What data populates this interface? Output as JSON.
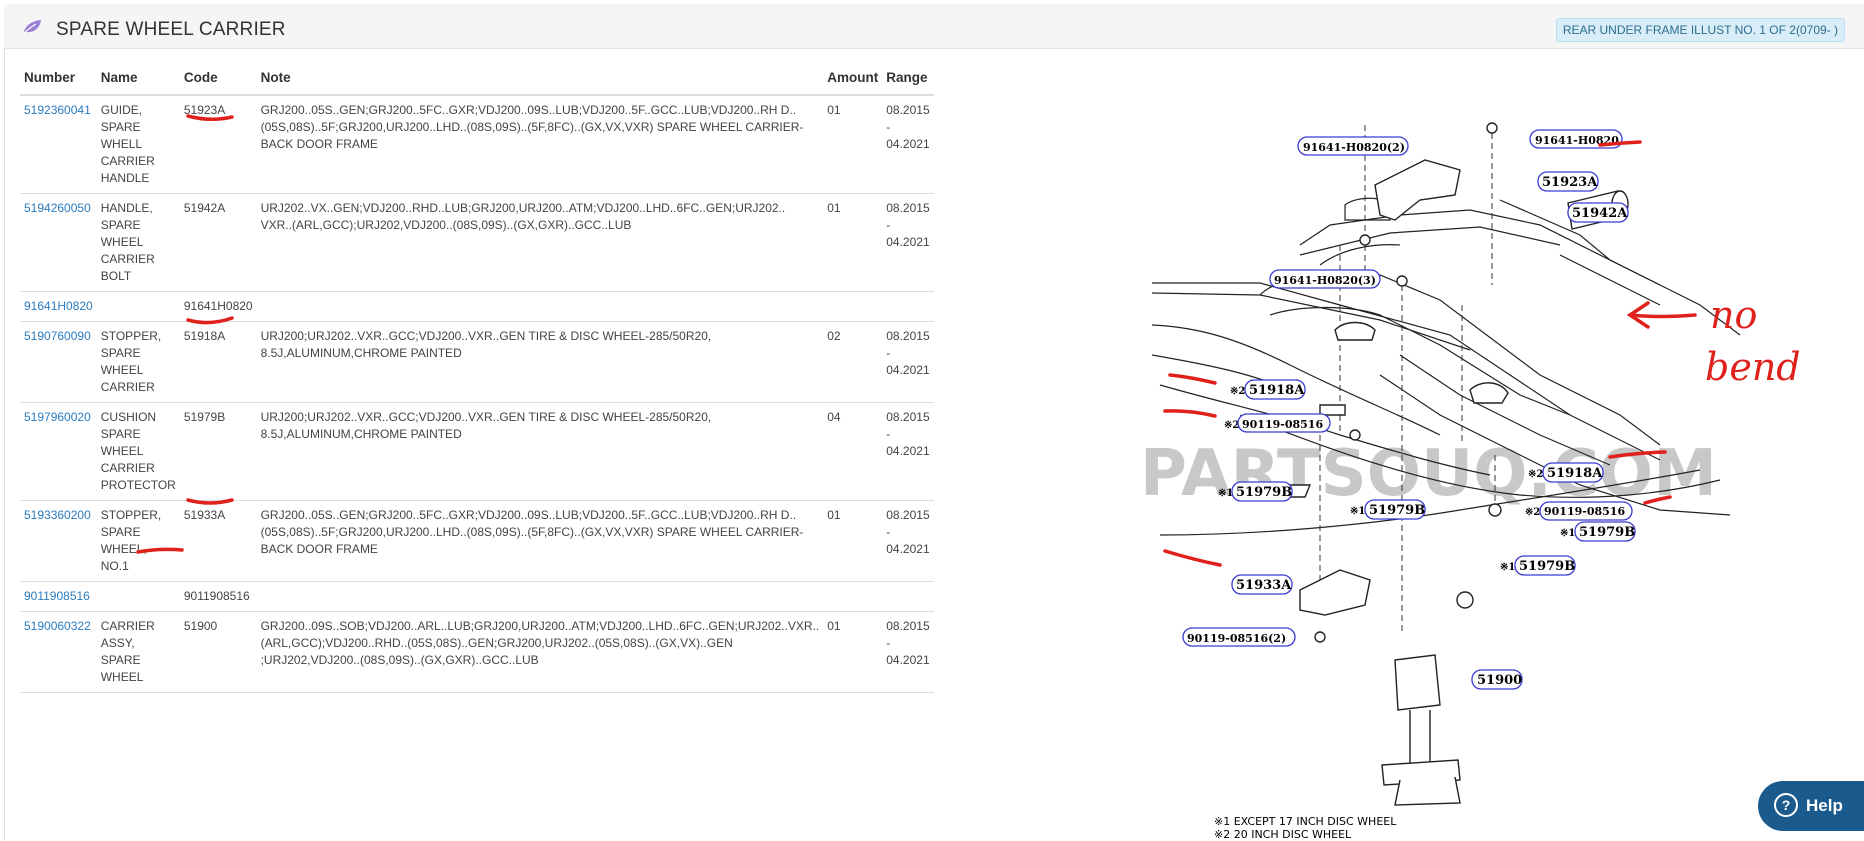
{
  "header": {
    "title": "SPARE WHEEL CARRIER",
    "illust_badge": "REAR UNDER FRAME ILLUST NO. 1 OF 2(0709- )"
  },
  "table": {
    "headers": [
      "Number",
      "Name",
      "Code",
      "Note",
      "Amount",
      "Range"
    ],
    "rows": [
      {
        "number": "5192360041",
        "name": "GUIDE, SPARE WHELL CARRIER HANDLE",
        "code": "51923A",
        "note": "GRJ200..05S..GEN;GRJ200..5FC..GXR;VDJ200..09S..LUB;VDJ200..5F..GCC..LUB;VDJ200..RH D..(05S,08S)..5F;GRJ200,URJ200..LHD..(08S,09S)..(5F,8FC)..(GX,VX,VXR) SPARE WHEEL CARRIER-BACK DOOR FRAME",
        "amount": "01",
        "range": "08.2015 - 04.2021"
      },
      {
        "number": "5194260050",
        "name": "HANDLE, SPARE WHEEL CARRIER BOLT",
        "code": "51942A",
        "note": "URJ202..VX..GEN;VDJ200..RHD..LUB;GRJ200,URJ200..ATM;VDJ200..LHD..6FC..GEN;URJ202.. VXR..(ARL,GCC);URJ202,VDJ200..(08S,09S)..(GX,GXR)..GCC..LUB",
        "amount": "01",
        "range": "08.2015 - 04.2021"
      },
      {
        "number": "91641H0820",
        "name": "",
        "code": "91641H0820",
        "note": "",
        "amount": "",
        "range": ""
      },
      {
        "number": "5190760090",
        "name": "STOPPER, SPARE WHEEL CARRIER",
        "code": "51918A",
        "note": "URJ200;URJ202..VXR..GCC;VDJ200..VXR..GEN TIRE & DISC WHEEL-285/50R20, 8.5J,ALUMINUM,CHROME PAINTED",
        "amount": "02",
        "range": "08.2015 - 04.2021"
      },
      {
        "number": "5197960020",
        "name": "CUSHION SPARE WHEEL CARRIER PROTECTOR",
        "code": "51979B",
        "note": "URJ200;URJ202..VXR..GCC;VDJ200..VXR..GEN TIRE & DISC WHEEL-285/50R20, 8.5J,ALUMINUM,CHROME PAINTED",
        "amount": "04",
        "range": "08.2015 - 04.2021"
      },
      {
        "number": "5193360200",
        "name": "STOPPER, SPARE WHEEL, NO.1",
        "code": "51933A",
        "note": "GRJ200..05S..GEN;GRJ200..5FC..GXR;VDJ200..09S..LUB;VDJ200..5F..GCC..LUB;VDJ200..RH D..(05S,08S)..5F;GRJ200,URJ200..LHD..(08S,09S)..(5F,8FC)..(GX,VX,VXR) SPARE WHEEL CARRIER-BACK DOOR FRAME",
        "amount": "01",
        "range": "08.2015 - 04.2021"
      },
      {
        "number": "9011908516",
        "name": "",
        "code": "9011908516",
        "note": "",
        "amount": "",
        "range": ""
      },
      {
        "number": "5190060322",
        "name": "CARRIER ASSY, SPARE WHEEL",
        "code": "51900",
        "note": "GRJ200..09S..SOB;VDJ200..ARL..LUB;GRJ200,URJ200..ATM;VDJ200..LHD..6FC..GEN;URJ202..VXR..(ARL,GCC);VDJ200..RHD..(05S,08S)..GEN;GRJ200,URJ202..(05S,08S)..(GX,VX)..GEN ;URJ202,VDJ200..(08S,09S)..(GX,GXR)..GCC..LUB",
        "amount": "01",
        "range": "08.2015 - 04.2021"
      }
    ]
  },
  "diagram": {
    "labels": [
      "91641-H0820(2)",
      "91641-H0820",
      "51923A",
      "51942A",
      "91641-H0820(3)",
      "51918A",
      "90119-08516",
      "51979B",
      "51918A",
      "90119-08516",
      "51979B",
      "51979B",
      "51979B",
      "51933A",
      "90119-08516(2)",
      "51900"
    ],
    "prefix_1": "※1",
    "prefix_2": "※2",
    "watermark": "PARTSOUQ.COM",
    "annotation": [
      "no",
      "bend"
    ],
    "footnotes": [
      "※1 EXCEPT 17 INCH DISC WHEEL",
      "※2 20 INCH DISC WHEEL"
    ]
  },
  "help": {
    "label": "Help"
  },
  "colors": {
    "link": "#2a7bbf",
    "annotation_red": "#e0201b",
    "label_border": "#3a3ad0",
    "help_bg": "#1a5a8c"
  }
}
